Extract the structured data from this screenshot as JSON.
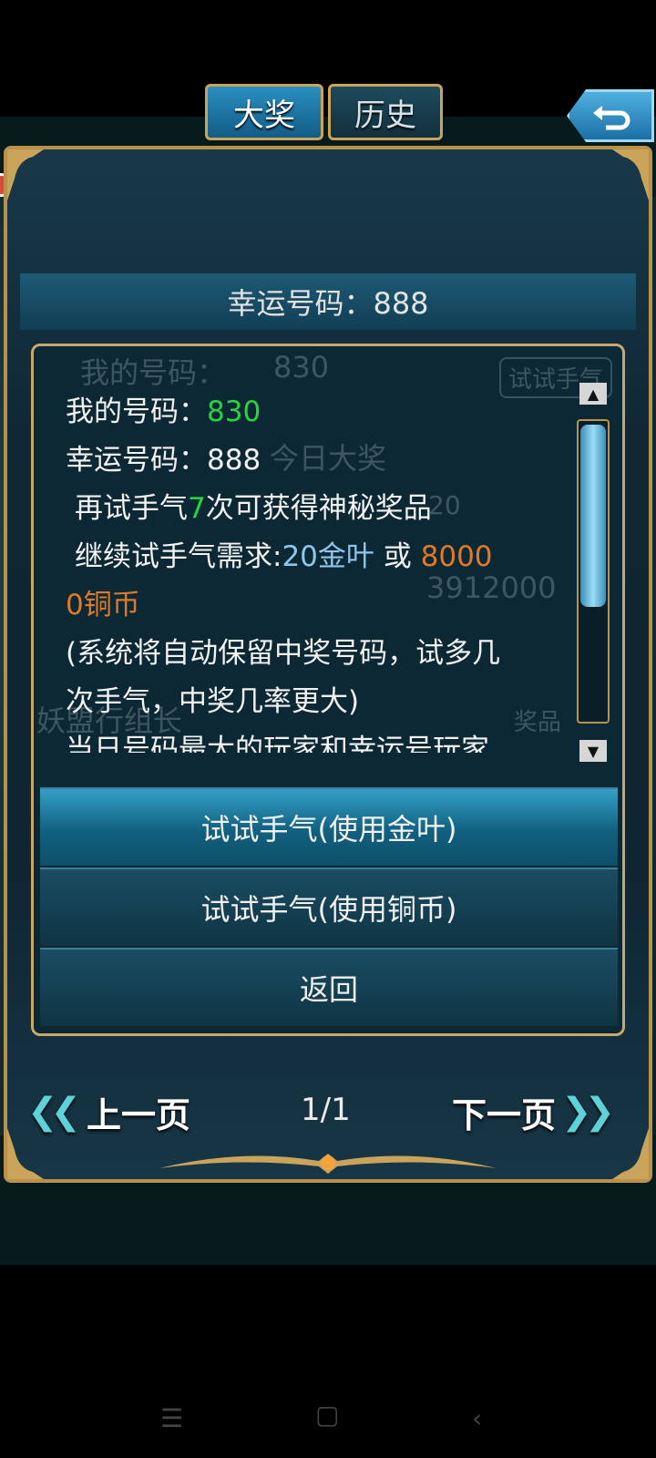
{
  "tabs": [
    {
      "label": "大奖",
      "active": true
    },
    {
      "label": "历史",
      "active": false
    }
  ],
  "back_icon": "return-arrow-icon",
  "panel_title": "幸运号码：888",
  "background_ghost": {
    "my_number_label": "我的号码：",
    "my_number_value": "830",
    "try_button": "试试手气",
    "today_prize": "今日大奖",
    "coins_value": "3912000",
    "member": "妖盟行组长",
    "prize_button": "奖品",
    "small_num": "20"
  },
  "info": {
    "my_number_label": "我的号码：",
    "my_number_value": "830",
    "lucky_number_label": "幸运号码：",
    "lucky_number_value": "888",
    "retry_prefix": "再试手气",
    "retry_count": "7",
    "retry_suffix": "次可获得神秘奖品",
    "cost_prefix": "继续试手气需求:",
    "cost_gold": "20金叶",
    "cost_or": " 或 ",
    "cost_copper_1": "8000",
    "cost_copper_2": "0铜币",
    "note_1": "(系统将自动保留中奖号码，试多几",
    "note_2": "次手气，中奖几率更大)",
    "cut_line": "当日号码最大的玩家和幸运号玩家"
  },
  "options": [
    "试试手气(使用金叶)",
    "试试手气(使用铜币)",
    "返回"
  ],
  "pager": {
    "prev": "上一页",
    "next": "下一页",
    "page": "1/1"
  },
  "colors": {
    "highlight_green": "#27d53f",
    "highlight_blue": "#8fc6ec",
    "highlight_orange": "#e07a2a",
    "frame_gold": "#c7a76a"
  },
  "navbar": [
    "menu-icon",
    "home-icon",
    "back-icon"
  ]
}
